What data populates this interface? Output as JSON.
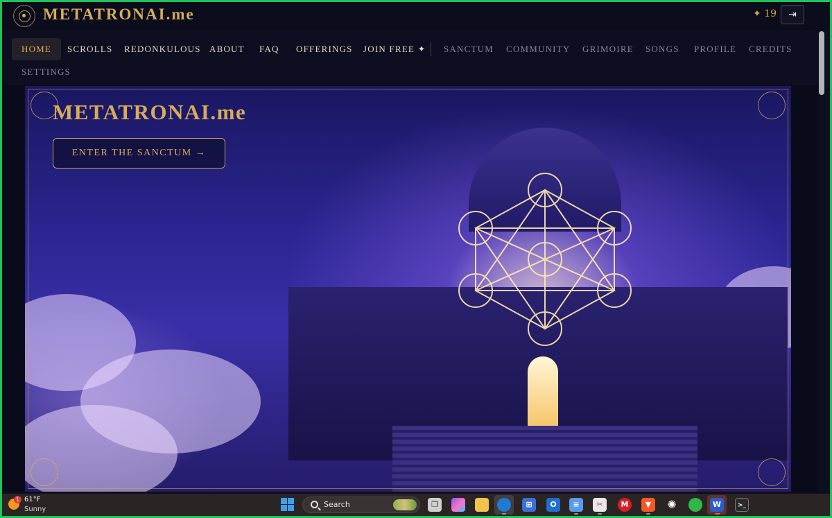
{
  "header": {
    "brand": "METATRONAI.me",
    "star_count": "✦ 19",
    "logout_icon": "logout-icon"
  },
  "nav": {
    "primary": [
      "HOME",
      "SCROLLS",
      "REDONKULOUS",
      "ABOUT",
      "FAQ",
      "OFFERINGS",
      "JOIN FREE ✦"
    ],
    "secondary": [
      "SANCTUM",
      "COMMUNITY",
      "GRIMOIRE",
      "SONGS",
      "PROFILE",
      "CREDITS",
      "SETTINGS"
    ],
    "active": "HOME"
  },
  "hero": {
    "title": "METATRONAI.me",
    "cta_label": "ENTER THE SANCTUM →"
  },
  "taskbar": {
    "weather_temp": "61°F",
    "weather_condition": "Sunny",
    "weather_badge": "1",
    "search_label": "Search",
    "apps": [
      "task-view-icon",
      "copilot-icon",
      "file-explorer-icon",
      "edge-icon",
      "store-icon",
      "outlook-icon",
      "notepad-icon",
      "snipping-icon",
      "m-app-icon",
      "brave-icon",
      "chatgpt-icon",
      "razer-icon",
      "word-icon",
      "terminal-icon"
    ]
  },
  "colors": {
    "accent_gold": "#d8ab58",
    "background": "#0a0b1a",
    "frame": "#1ec35a"
  }
}
